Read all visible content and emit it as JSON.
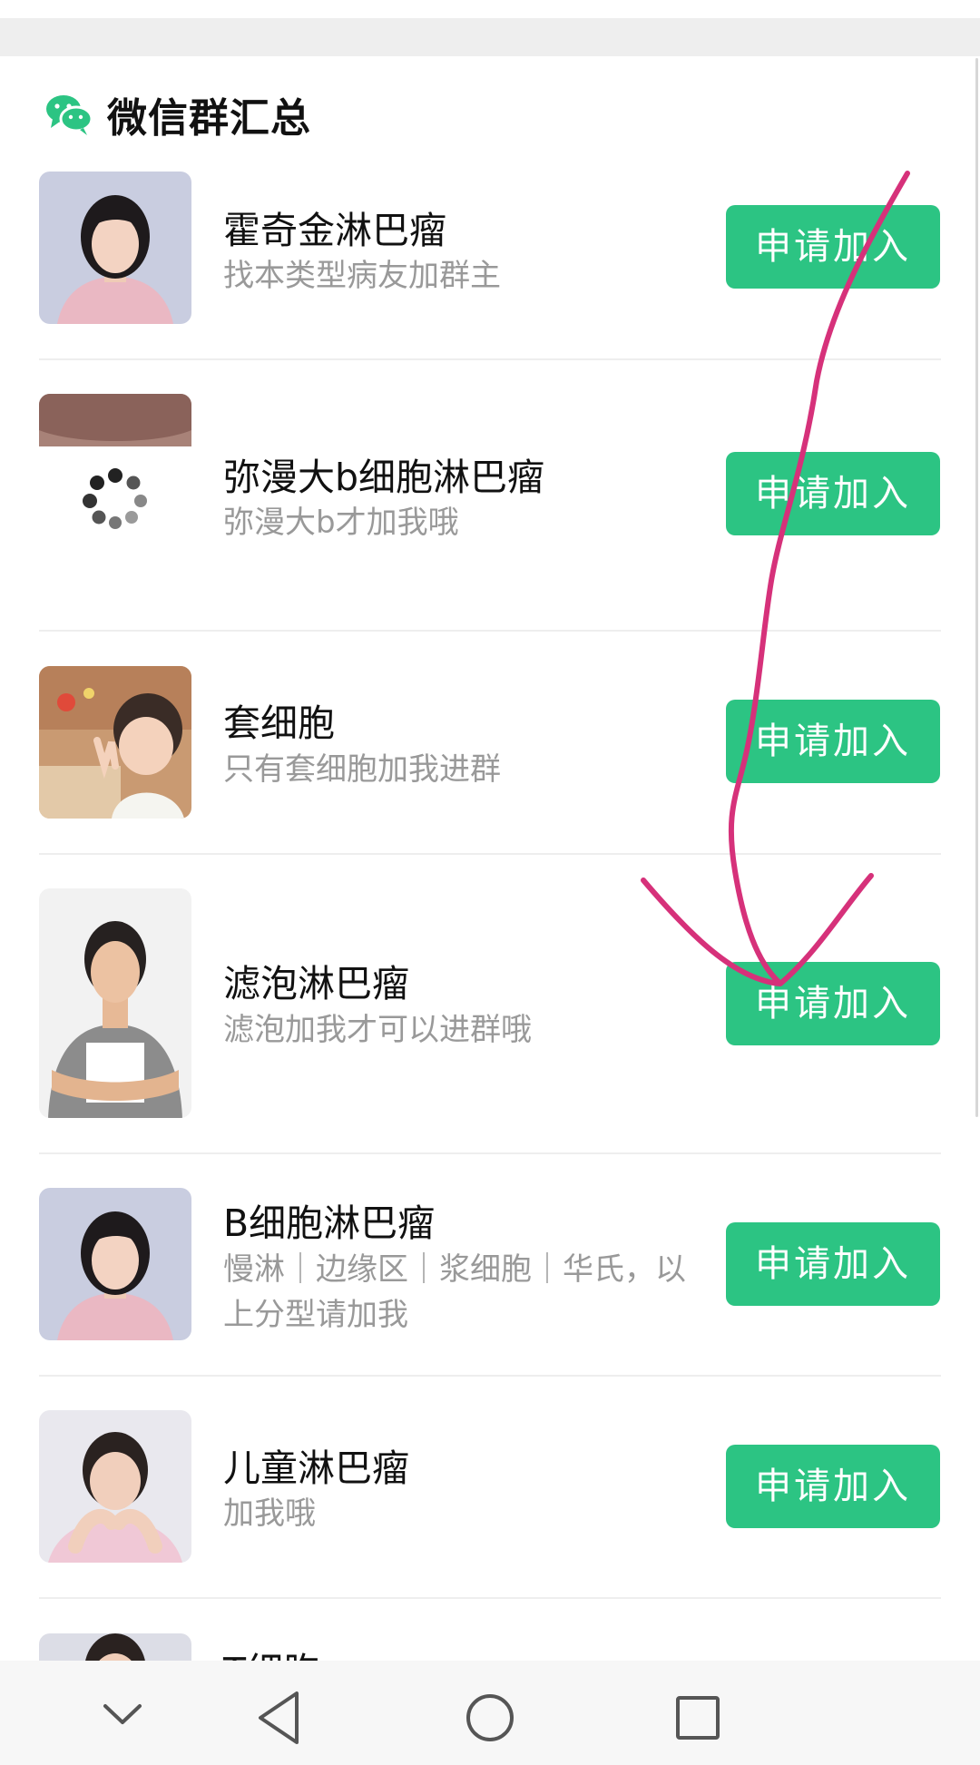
{
  "header": {
    "title": "微信群汇总",
    "icon": "wechat-icon",
    "icon_color": "#2cc483"
  },
  "groups": [
    {
      "name": "霍奇金淋巴瘤",
      "desc": "找本类型病友加群主",
      "button": "申请加入",
      "avatar": "woman-pink-shirt-photo"
    },
    {
      "name": "弥漫大b细胞淋巴瘤",
      "desc": "弥漫大b才加我哦",
      "button": "申请加入",
      "avatar": "loading-spinner-photo"
    },
    {
      "name": "套细胞",
      "desc": "只有套细胞加我进群",
      "button": "申请加入",
      "avatar": "child-peace-sign-photo"
    },
    {
      "name": "滤泡淋巴瘤",
      "desc": "滤泡加我才可以进群哦",
      "button": "申请加入",
      "avatar": "man-arms-crossed-photo"
    },
    {
      "name": "B细胞淋巴瘤",
      "desc": "慢淋｜边缘区｜浆细胞｜华氏，以上分型请加我",
      "button": "申请加入",
      "avatar": "woman-pink-shirt-photo"
    },
    {
      "name": "儿童淋巴瘤",
      "desc": "加我哦",
      "button": "申请加入",
      "avatar": "woman-hands-under-chin-photo"
    },
    {
      "name": "T细胞",
      "desc": "",
      "button": "",
      "avatar": "woman-photo-partial"
    }
  ],
  "colors": {
    "accent": "#2cc483",
    "annotation_stroke": "#d6317a",
    "text_primary": "#111111",
    "text_secondary": "#999999"
  },
  "nav_bar": {
    "items": [
      "chevron-down-icon",
      "back-triangle-icon",
      "home-circle-icon",
      "recents-square-icon"
    ]
  }
}
